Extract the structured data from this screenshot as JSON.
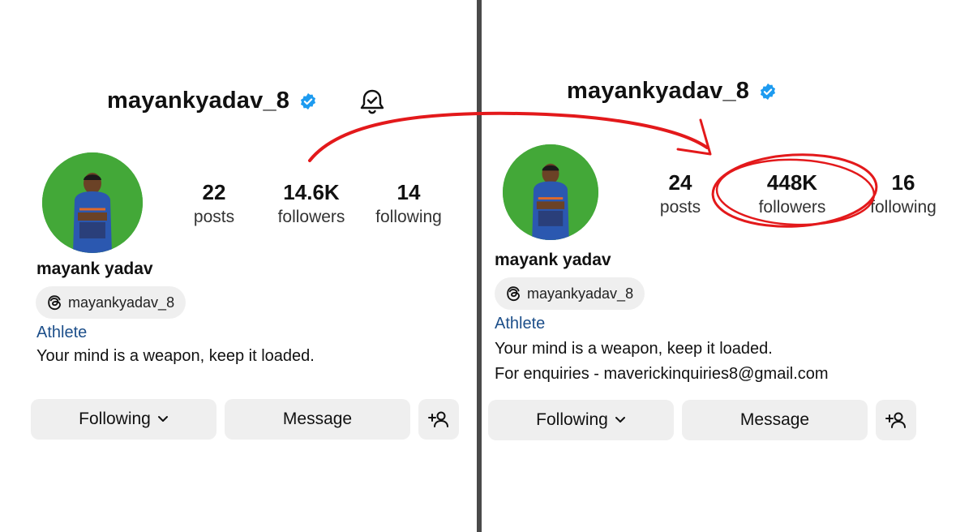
{
  "left": {
    "username": "mayankyadav_8",
    "stats": [
      {
        "value": "22",
        "label": "posts"
      },
      {
        "value": "14.6K",
        "label": "followers"
      },
      {
        "value": "14",
        "label": "following"
      }
    ],
    "display_name": "mayank yadav",
    "threads_handle": "mayankyadav_8",
    "category": "Athlete",
    "bio_lines": [
      "Your mind is a weapon, keep it loaded."
    ],
    "buttons": {
      "following": "Following",
      "message": "Message"
    }
  },
  "right": {
    "username": "mayankyadav_8",
    "stats": [
      {
        "value": "24",
        "label": "posts"
      },
      {
        "value": "448K",
        "label": "followers"
      },
      {
        "value": "16",
        "label": "following"
      }
    ],
    "display_name": "mayank yadav",
    "threads_handle": "mayankyadav_8",
    "category": "Athlete",
    "bio_lines": [
      "Your mind is a weapon, keep it loaded.",
      "For enquiries - maverickinquiries8@gmail.com"
    ],
    "buttons": {
      "following": "Following",
      "message": "Message"
    }
  },
  "colors": {
    "verified": "#1d9bf0",
    "annotation": "#e3191b",
    "category_link": "#1d4f8a",
    "button_bg": "#efefef",
    "avatar_bg": "#43a838"
  },
  "icons": [
    "verified-badge-icon",
    "bell-check-icon",
    "threads-icon",
    "chevron-down-icon",
    "add-person-icon",
    "curved-arrow",
    "circle-highlight"
  ]
}
